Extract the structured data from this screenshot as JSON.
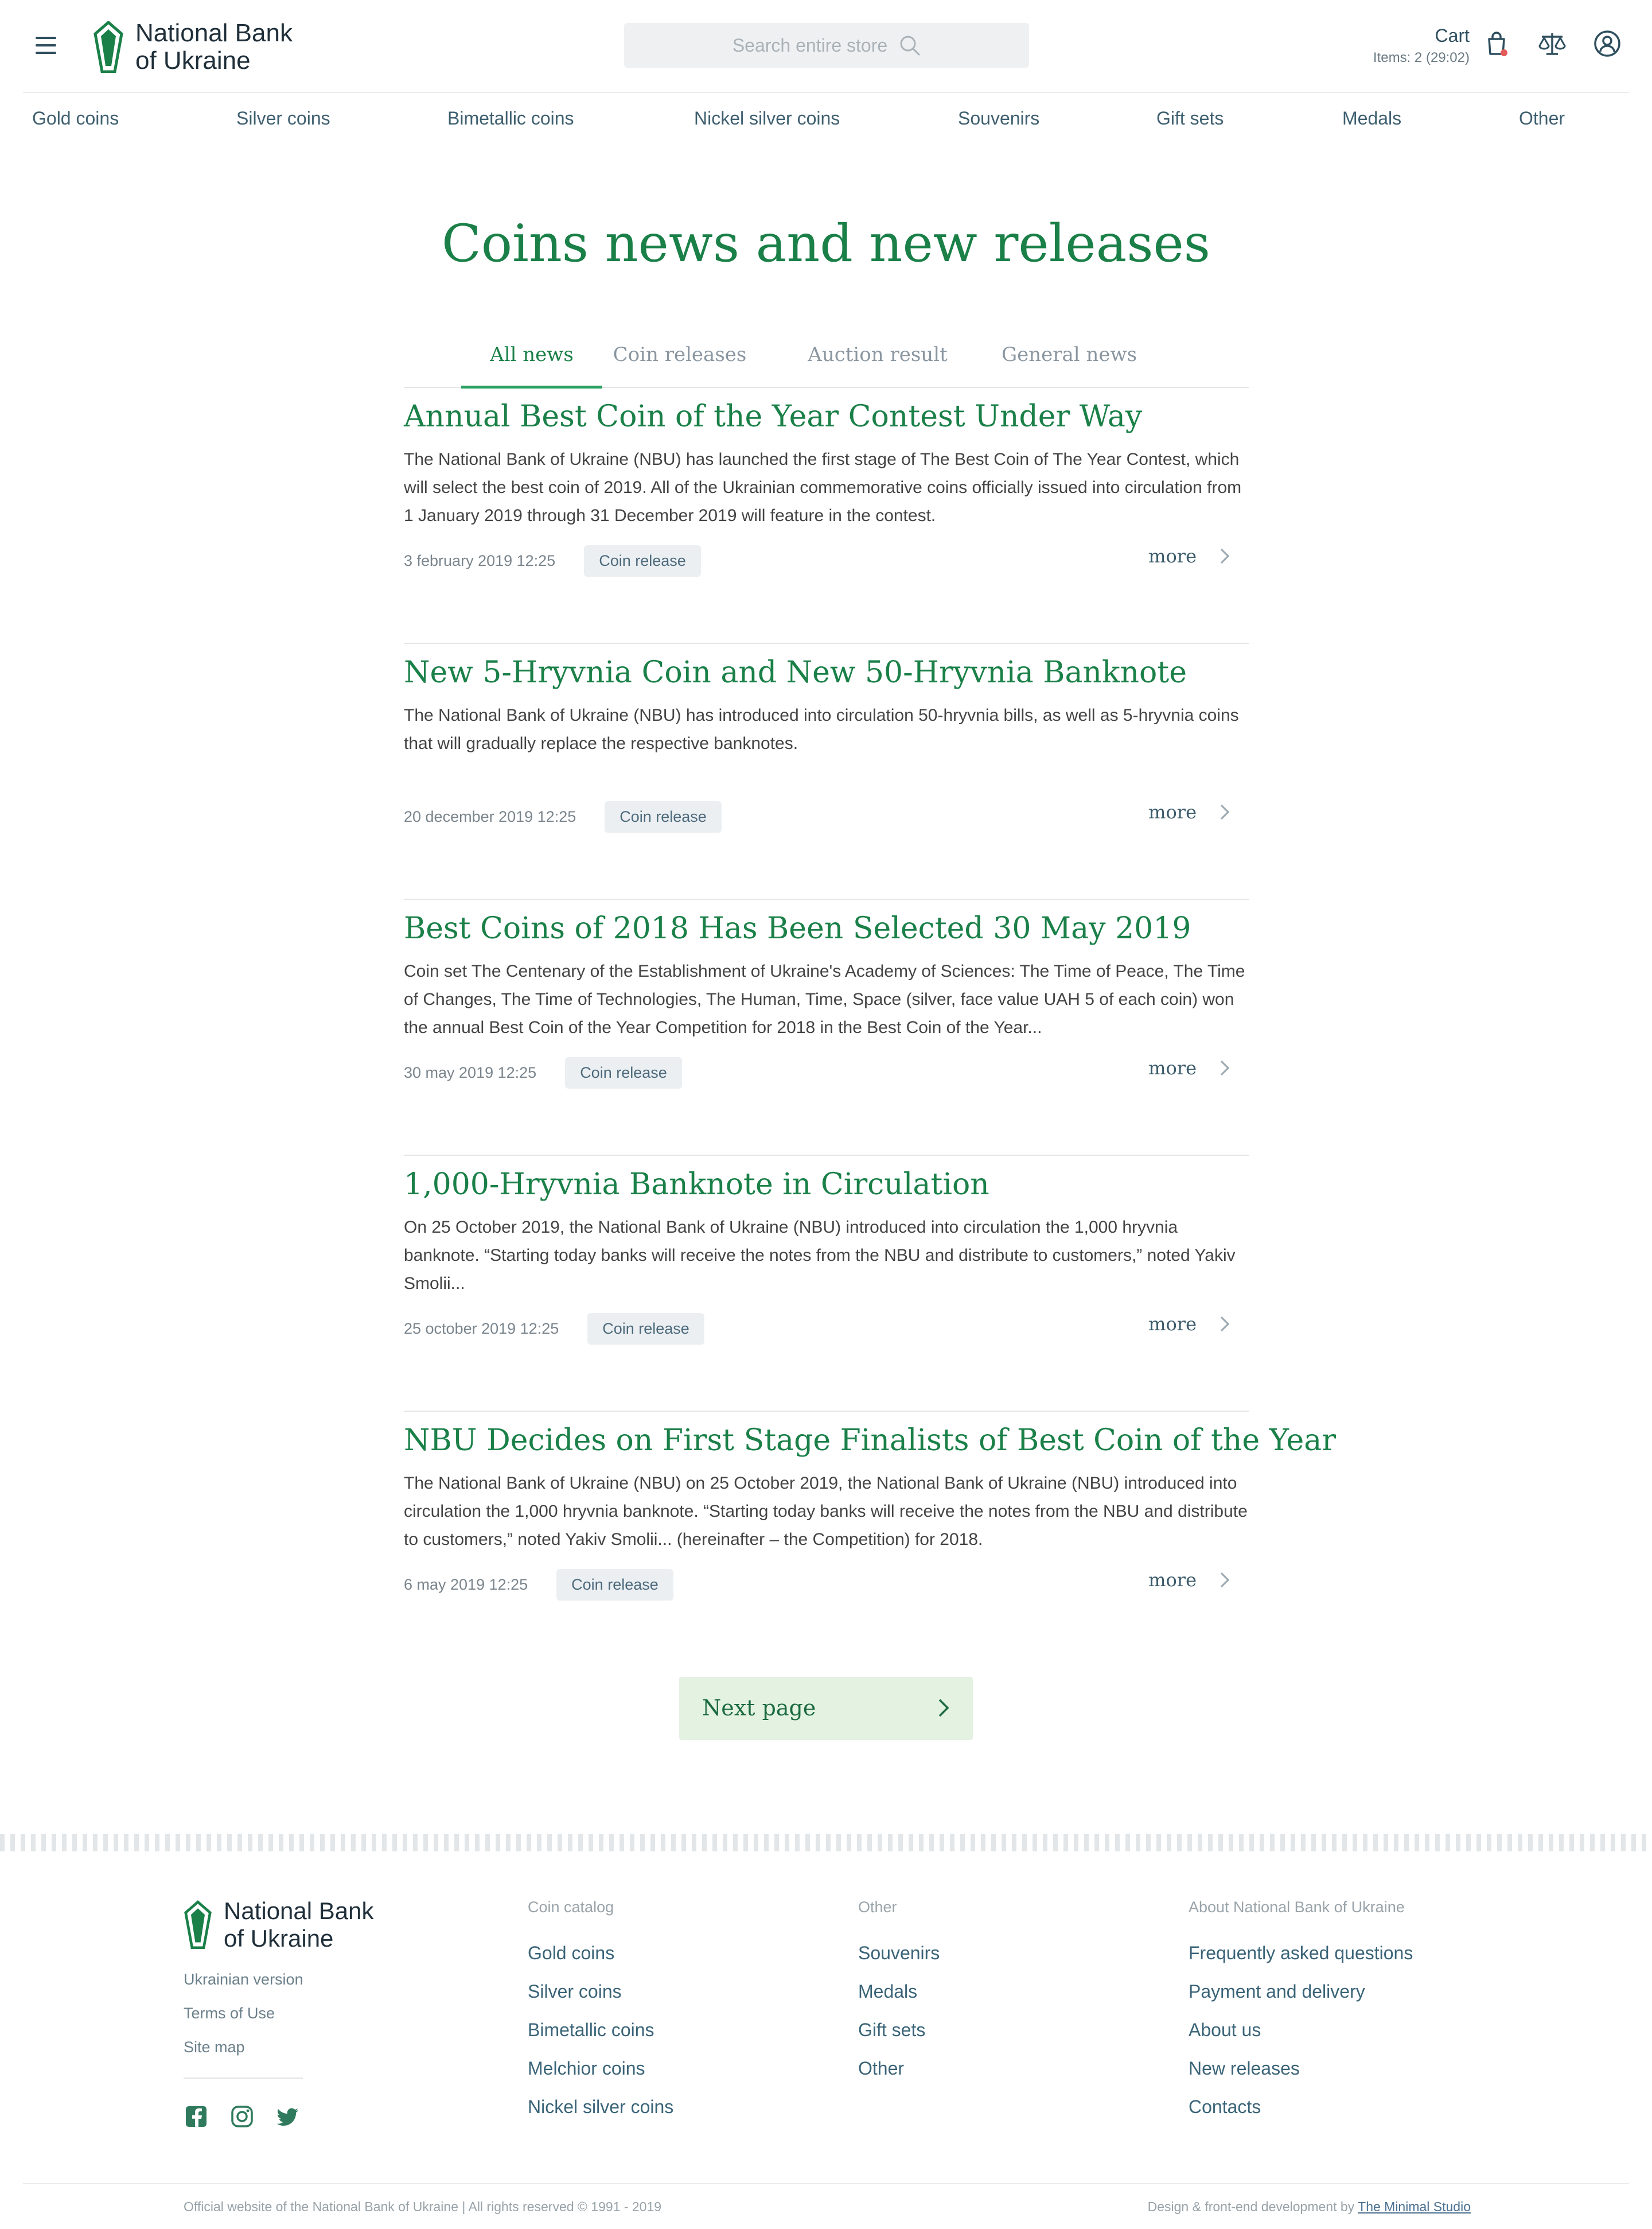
{
  "header": {
    "logo_text": "National Bank of Ukraine",
    "logo_line1": "National Bank",
    "logo_line2": "of Ukraine",
    "search_placeholder": "Search entire store",
    "cart_title": "Cart",
    "cart_items": "Items: 2 (29:02)"
  },
  "topnav": [
    "Gold coins",
    "Silver coins",
    "Bimetallic coins",
    "Nickel silver coins",
    "Souvenirs",
    "Gift sets",
    "Medals",
    "Other"
  ],
  "page_title": "Coins news and new releases",
  "tabs": [
    {
      "label": "All news",
      "active": true
    },
    {
      "label": "Coin releases",
      "active": false
    },
    {
      "label": "Auction result",
      "active": false
    },
    {
      "label": "General news",
      "active": false
    }
  ],
  "articles": [
    {
      "title": "Annual Best Coin of the Year Contest Under Way",
      "body": "The National Bank of Ukraine (NBU) has launched the first stage of The Best Coin of The Year Contest, which will select the best coin of 2019. All of the Ukrainian commemorative coins officially issued into circulation from 1 January 2019 through 31 December 2019 will feature in the contest.",
      "date": "3 february 2019 12:25",
      "badge": "Coin release",
      "more": "more"
    },
    {
      "title": "New 5-Hryvnia Coin and New 50-Hryvnia Banknote",
      "body": "The National Bank of Ukraine (NBU) has introduced into circulation 50-hryvnia bills, as well as 5-hryvnia coins that will gradually replace the respective banknotes.",
      "date": "20 december 2019 12:25",
      "badge": "Coin release",
      "more": "more"
    },
    {
      "title": "Best Coins of 2018 Has Been Selected 30 May 2019",
      "body": "Coin set The Centenary of the Establishment of Ukraine's Academy of Sciences: The Time of Peace, The Time of Changes, The Time of Technologies, The Human, Time, Space (silver, face value UAH 5 of each coin) won the annual Best Coin of the Year Competition for 2018 in the Best Coin of the Year...",
      "date": "30 may 2019 12:25",
      "badge": "Coin release",
      "more": "more"
    },
    {
      "title": "1,000-Hryvnia Banknote in Circulation",
      "body": "On 25 October 2019, the National Bank of Ukraine (NBU) introduced into circulation the 1,000 hryvnia banknote.  “Starting today banks will receive the notes from the NBU and distribute to customers,” noted Yakiv Smolii...",
      "date": "25 october 2019 12:25",
      "badge": "Coin release",
      "more": "more"
    },
    {
      "title": "NBU Decides on First Stage Finalists of Best Coin of the Year",
      "body": "The National Bank of Ukraine (NBU) on 25 October 2019, the National Bank of Ukraine (NBU) introduced into circulation the 1,000 hryvnia banknote.  “Starting today banks will receive the notes from the NBU and distribute to customers,” noted Yakiv Smolii... (hereinafter – the Competition) for 2018.",
      "date": "6 may 2019 12:25",
      "badge": "Coin release",
      "more": "more"
    }
  ],
  "next_page": "Next page",
  "footer": {
    "logo_line1": "National Bank",
    "logo_line2": "of Ukraine",
    "links": [
      "Ukrainian version",
      "Terms of Use",
      "Site map"
    ],
    "columns": [
      {
        "heading": "Coin catalog",
        "items": [
          "Gold coins",
          "Silver coins",
          "Bimetallic coins",
          "Melchior coins",
          "Nickel silver coins"
        ]
      },
      {
        "heading": "Other",
        "items": [
          "Souvenirs",
          "Medals",
          "Gift sets",
          "Other"
        ]
      },
      {
        "heading": "About National Bank of Ukraine",
        "items": [
          "Frequently asked questions",
          "Payment and delivery",
          "About us",
          "New releases",
          "Contacts"
        ]
      }
    ],
    "copyright": "Official website of the National Bank of Ukraine | All rights reserved © 1991 - 2019",
    "design_by_prefix": "Design & front-end development by",
    "design_by_link": "The Minimal Studio"
  },
  "colors": {
    "accent_green": "#1a8048",
    "button_bg": "#e4f2e1",
    "badge_bg": "#eceff2"
  }
}
